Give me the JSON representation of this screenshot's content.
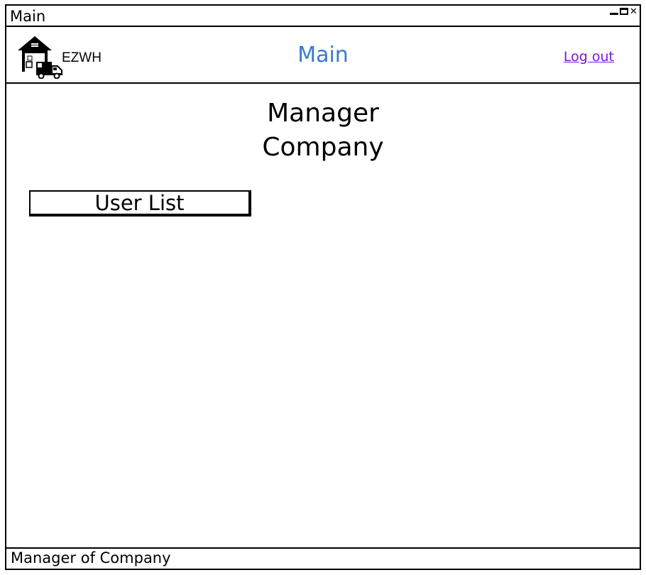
{
  "window": {
    "title": "Main"
  },
  "header": {
    "brand": "EZWH",
    "title": "Main",
    "logout_label": "Log out"
  },
  "main": {
    "role_line1": "Manager",
    "role_line2": "Company",
    "user_list_label": "User List"
  },
  "statusbar": {
    "text": "Manager of Company"
  },
  "icons": {
    "logo": "warehouse-truck-icon",
    "minimize": "minimize-icon",
    "maximize": "maximize-icon",
    "close": "close-icon"
  },
  "colors": {
    "header_title": "#3a78d0",
    "logout_link": "#7b14e0"
  }
}
